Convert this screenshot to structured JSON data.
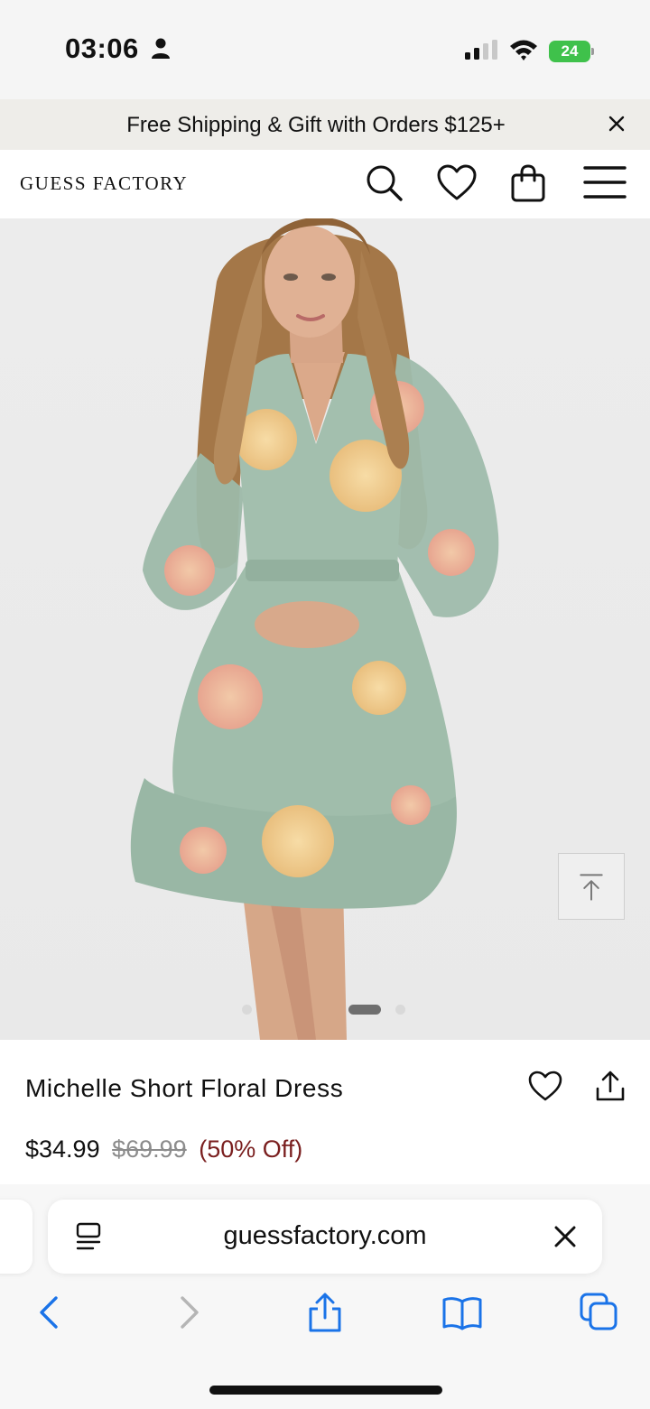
{
  "status": {
    "time": "03:06",
    "battery": "24",
    "battery_color": "#3fc14b"
  },
  "promo": {
    "text": "Free Shipping & Gift with Orders $125+",
    "close_icon": "close-icon"
  },
  "header": {
    "logo": "GUESS FACTORY",
    "icons": [
      "search-icon",
      "heart-icon",
      "shopping-bag-icon",
      "hamburger-menu-icon"
    ]
  },
  "carousel": {
    "image_count": 3,
    "active_index": 2,
    "scroll_top_icon": "arrow-up-to-top-icon"
  },
  "product": {
    "name": "Michelle Short Floral Dress",
    "price_sale": "$34.99",
    "price_original": "$69.99",
    "discount": "(50% Off)",
    "discount_color": "#7a1f1f",
    "icons": [
      "heart-icon",
      "share-icon"
    ]
  },
  "browser": {
    "url": "guessfactory.com",
    "toolbar_icons": [
      "back-icon",
      "forward-icon",
      "share-icon",
      "bookmarks-icon",
      "tabs-icon"
    ],
    "accent_color": "#1a73e8"
  }
}
